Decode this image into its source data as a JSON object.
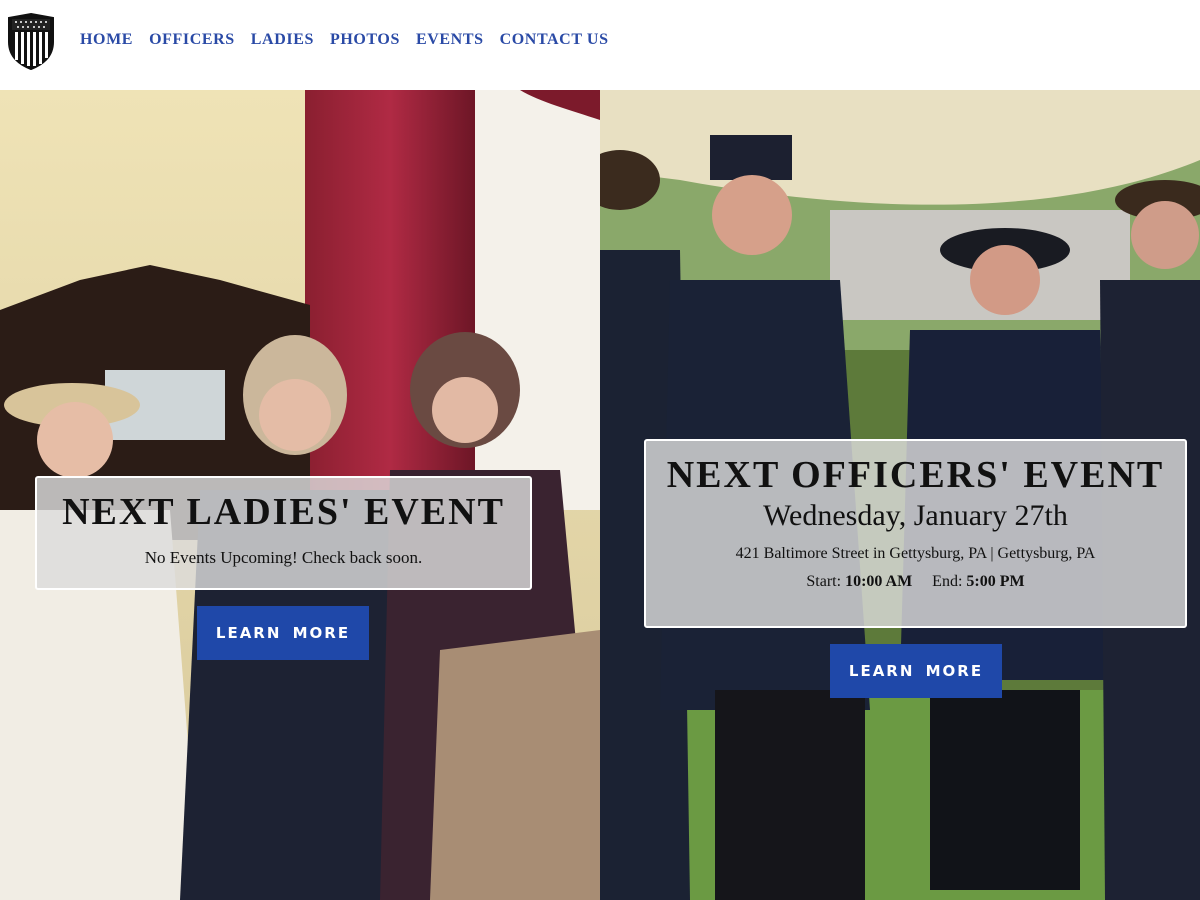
{
  "header": {
    "logo_icon": "shield-icon",
    "nav": [
      "HOME",
      "OFFICERS",
      "LADIES",
      "PHOTOS",
      "EVENTS",
      "CONTACT US"
    ]
  },
  "ladies": {
    "heading": "NEXT LADIES' EVENT",
    "message": "No Events Upcoming! Check back soon.",
    "button": "LEARN MORE"
  },
  "officers": {
    "heading": "NEXT OFFICERS' EVENT",
    "date": "Wednesday, January 27th",
    "address": "421 Baltimore Street in Gettysburg, PA | Gettysburg, PA",
    "start_label": "Start:",
    "start_time": "10:00 AM",
    "end_label": "End:",
    "end_time": "5:00 PM",
    "button": "LEARN MORE"
  },
  "colors": {
    "nav": "#2a4aa6",
    "button": "#1f48a9"
  }
}
